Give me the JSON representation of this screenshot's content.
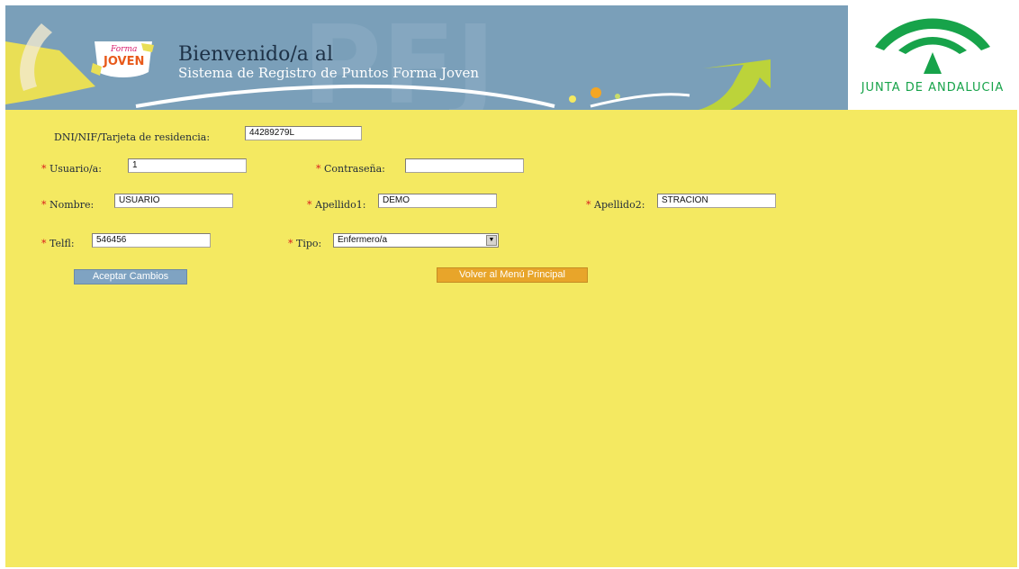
{
  "header": {
    "title_line1": "Bienvenido/a al",
    "title_line2": "Sistema de Registro de Puntos Forma Joven",
    "logo_text_top": "Forma",
    "logo_text_bottom": "JOVEN",
    "junta_label": "JUNTA DE ANDALUCIA"
  },
  "form": {
    "required_mark": "*",
    "dni": {
      "label": "DNI/NIF/Tarjeta de residencia:",
      "value": "44289279L"
    },
    "usuario": {
      "label": "Usuario/a:",
      "value": "1"
    },
    "contrasena": {
      "label": "Contraseña:",
      "value": ""
    },
    "nombre": {
      "label": "Nombre:",
      "value": "USUARIO"
    },
    "apellido1": {
      "label": "Apellido1:",
      "value": "DEMO"
    },
    "apellido2": {
      "label": "Apellido2:",
      "value": "STRACION"
    },
    "telf": {
      "label": "Telfl:",
      "value": "546456"
    },
    "tipo": {
      "label": "Tipo:",
      "value": "Enfermero/a"
    }
  },
  "buttons": {
    "accept": "Aceptar Cambios",
    "back": "Volver al Menú Principal"
  },
  "colors": {
    "header_bg": "#7a9fb9",
    "page_bg": "#f4e961",
    "accept_button": "#7fa3c2",
    "back_button": "#e8a52a",
    "junta_green": "#17a34a",
    "required_red": "#d81b1b"
  }
}
